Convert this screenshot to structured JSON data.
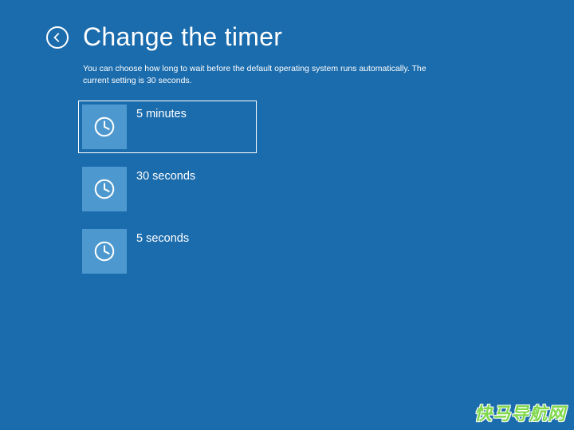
{
  "header": {
    "title": "Change the timer"
  },
  "description": "You can choose how long to wait before the default operating system runs automatically. The current setting is 30 seconds.",
  "options": [
    {
      "label": "5 minutes",
      "selected": true
    },
    {
      "label": "30 seconds",
      "selected": false
    },
    {
      "label": "5 seconds",
      "selected": false
    }
  ],
  "watermark": "快马导航网"
}
